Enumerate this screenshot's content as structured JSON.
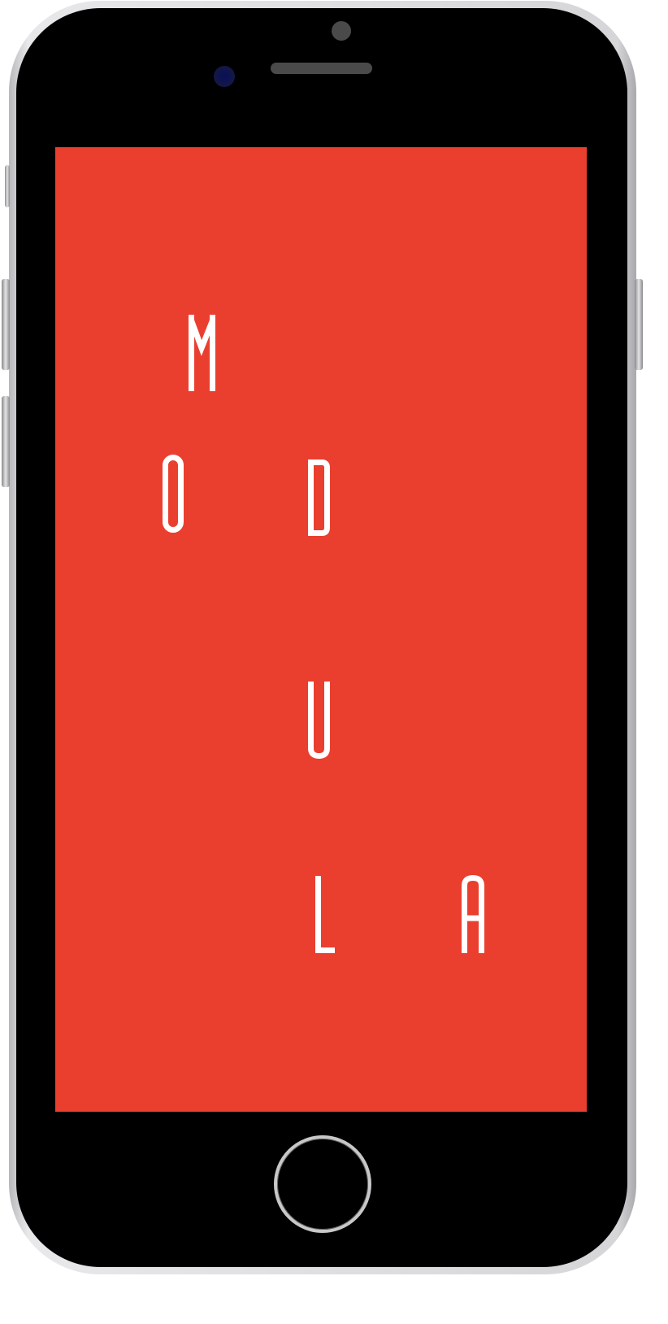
{
  "device": {
    "model": "smartphone-mockup"
  },
  "screen": {
    "background_color": "#ea3f2f",
    "logo_letters": [
      "M",
      "O",
      "D",
      "U",
      "L",
      "A"
    ],
    "logo_text": "MODULA",
    "letter_color": "#ffffff"
  }
}
